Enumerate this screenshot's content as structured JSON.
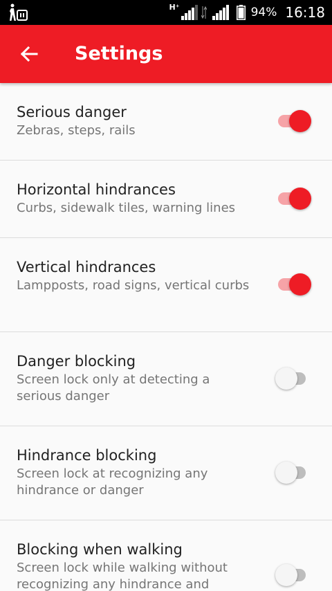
{
  "status_bar": {
    "network_type": "H⁺",
    "battery_percent": "94%",
    "time": "16:18",
    "left_icon": "walking-person-icon"
  },
  "app_bar": {
    "title": "Settings",
    "back_icon": "arrow-left-icon",
    "color": "#ee1c25"
  },
  "settings": [
    {
      "title": "Serious danger",
      "summary": "Zebras, steps, rails",
      "enabled": true
    },
    {
      "title": "Horizontal hindrances",
      "summary": "Curbs, sidewalk tiles, warning lines",
      "enabled": true
    },
    {
      "title": "Vertical hindrances",
      "summary": "Lampposts, road signs, vertical curbs",
      "enabled": true
    },
    {
      "title": "Danger blocking",
      "summary": "Screen lock only at detecting a serious danger",
      "enabled": false
    },
    {
      "title": "Hindrance blocking",
      "summary": "Screen lock at recognizing any hindrance or danger",
      "enabled": false
    },
    {
      "title": "Blocking when walking",
      "summary": "Screen lock while walking without recognizing any hindrance and",
      "enabled": false
    }
  ]
}
